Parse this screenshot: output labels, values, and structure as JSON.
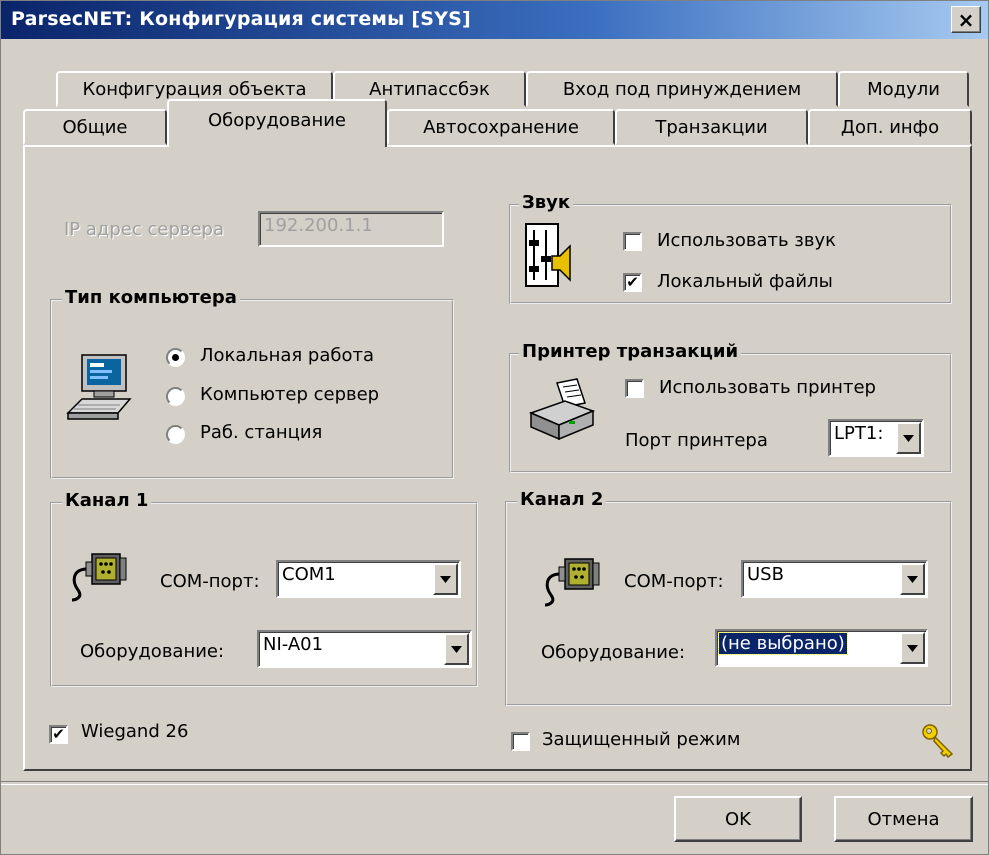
{
  "window": {
    "title": "ParsecNET: Конфигурация системы [SYS]",
    "close_label": "×"
  },
  "tabs": {
    "row1": [
      "Конфигурация объекта",
      "Антипассбэк",
      "Вход под принуждением",
      "Модули"
    ],
    "row2": [
      "Общие",
      "Оборудование",
      "Автосохранение",
      "Транзакции",
      "Доп. инфо"
    ],
    "active": "Оборудование"
  },
  "server": {
    "ip_label": "IP адрес сервера",
    "ip_value": "192.200.1.1"
  },
  "sound": {
    "title": "Звук",
    "use_sound": {
      "label": "Использовать звук",
      "checked": false
    },
    "local_files": {
      "label": "Локальный файлы",
      "checked": true
    },
    "check_mark": "✔"
  },
  "computer_type": {
    "title": "Тип компьютера",
    "options": [
      "Локальная работа",
      "Компьютер сервер",
      "Раб. станция"
    ],
    "selected": "Локальная работа"
  },
  "printer": {
    "title": "Принтер транзакций",
    "use_printer": {
      "label": "Использовать принтер",
      "checked": false
    },
    "port_label": "Порт принтера",
    "port_value": "LPT1:"
  },
  "channel1": {
    "title": "Канал 1",
    "com_label": "COM-порт:",
    "com_value": "COM1",
    "equip_label": "Оборудование:",
    "equip_value": "NI-A01"
  },
  "channel2": {
    "title": "Канал 2",
    "com_label": "COM-порт:",
    "com_value": "USB",
    "equip_label": "Оборудование:",
    "equip_value": "(не выбрано)"
  },
  "wiegand": {
    "label": "Wiegand 26",
    "checked": true
  },
  "protected_mode": {
    "label": "Защищенный режим",
    "checked": false
  },
  "buttons": {
    "ok": "OK",
    "cancel": "Отмена"
  },
  "icons": {
    "sound": "speaker-mixer-icon",
    "computer": "computer-icon",
    "printer": "printer-icon",
    "port": "com-port-cable-icon",
    "key": "key-icon"
  }
}
